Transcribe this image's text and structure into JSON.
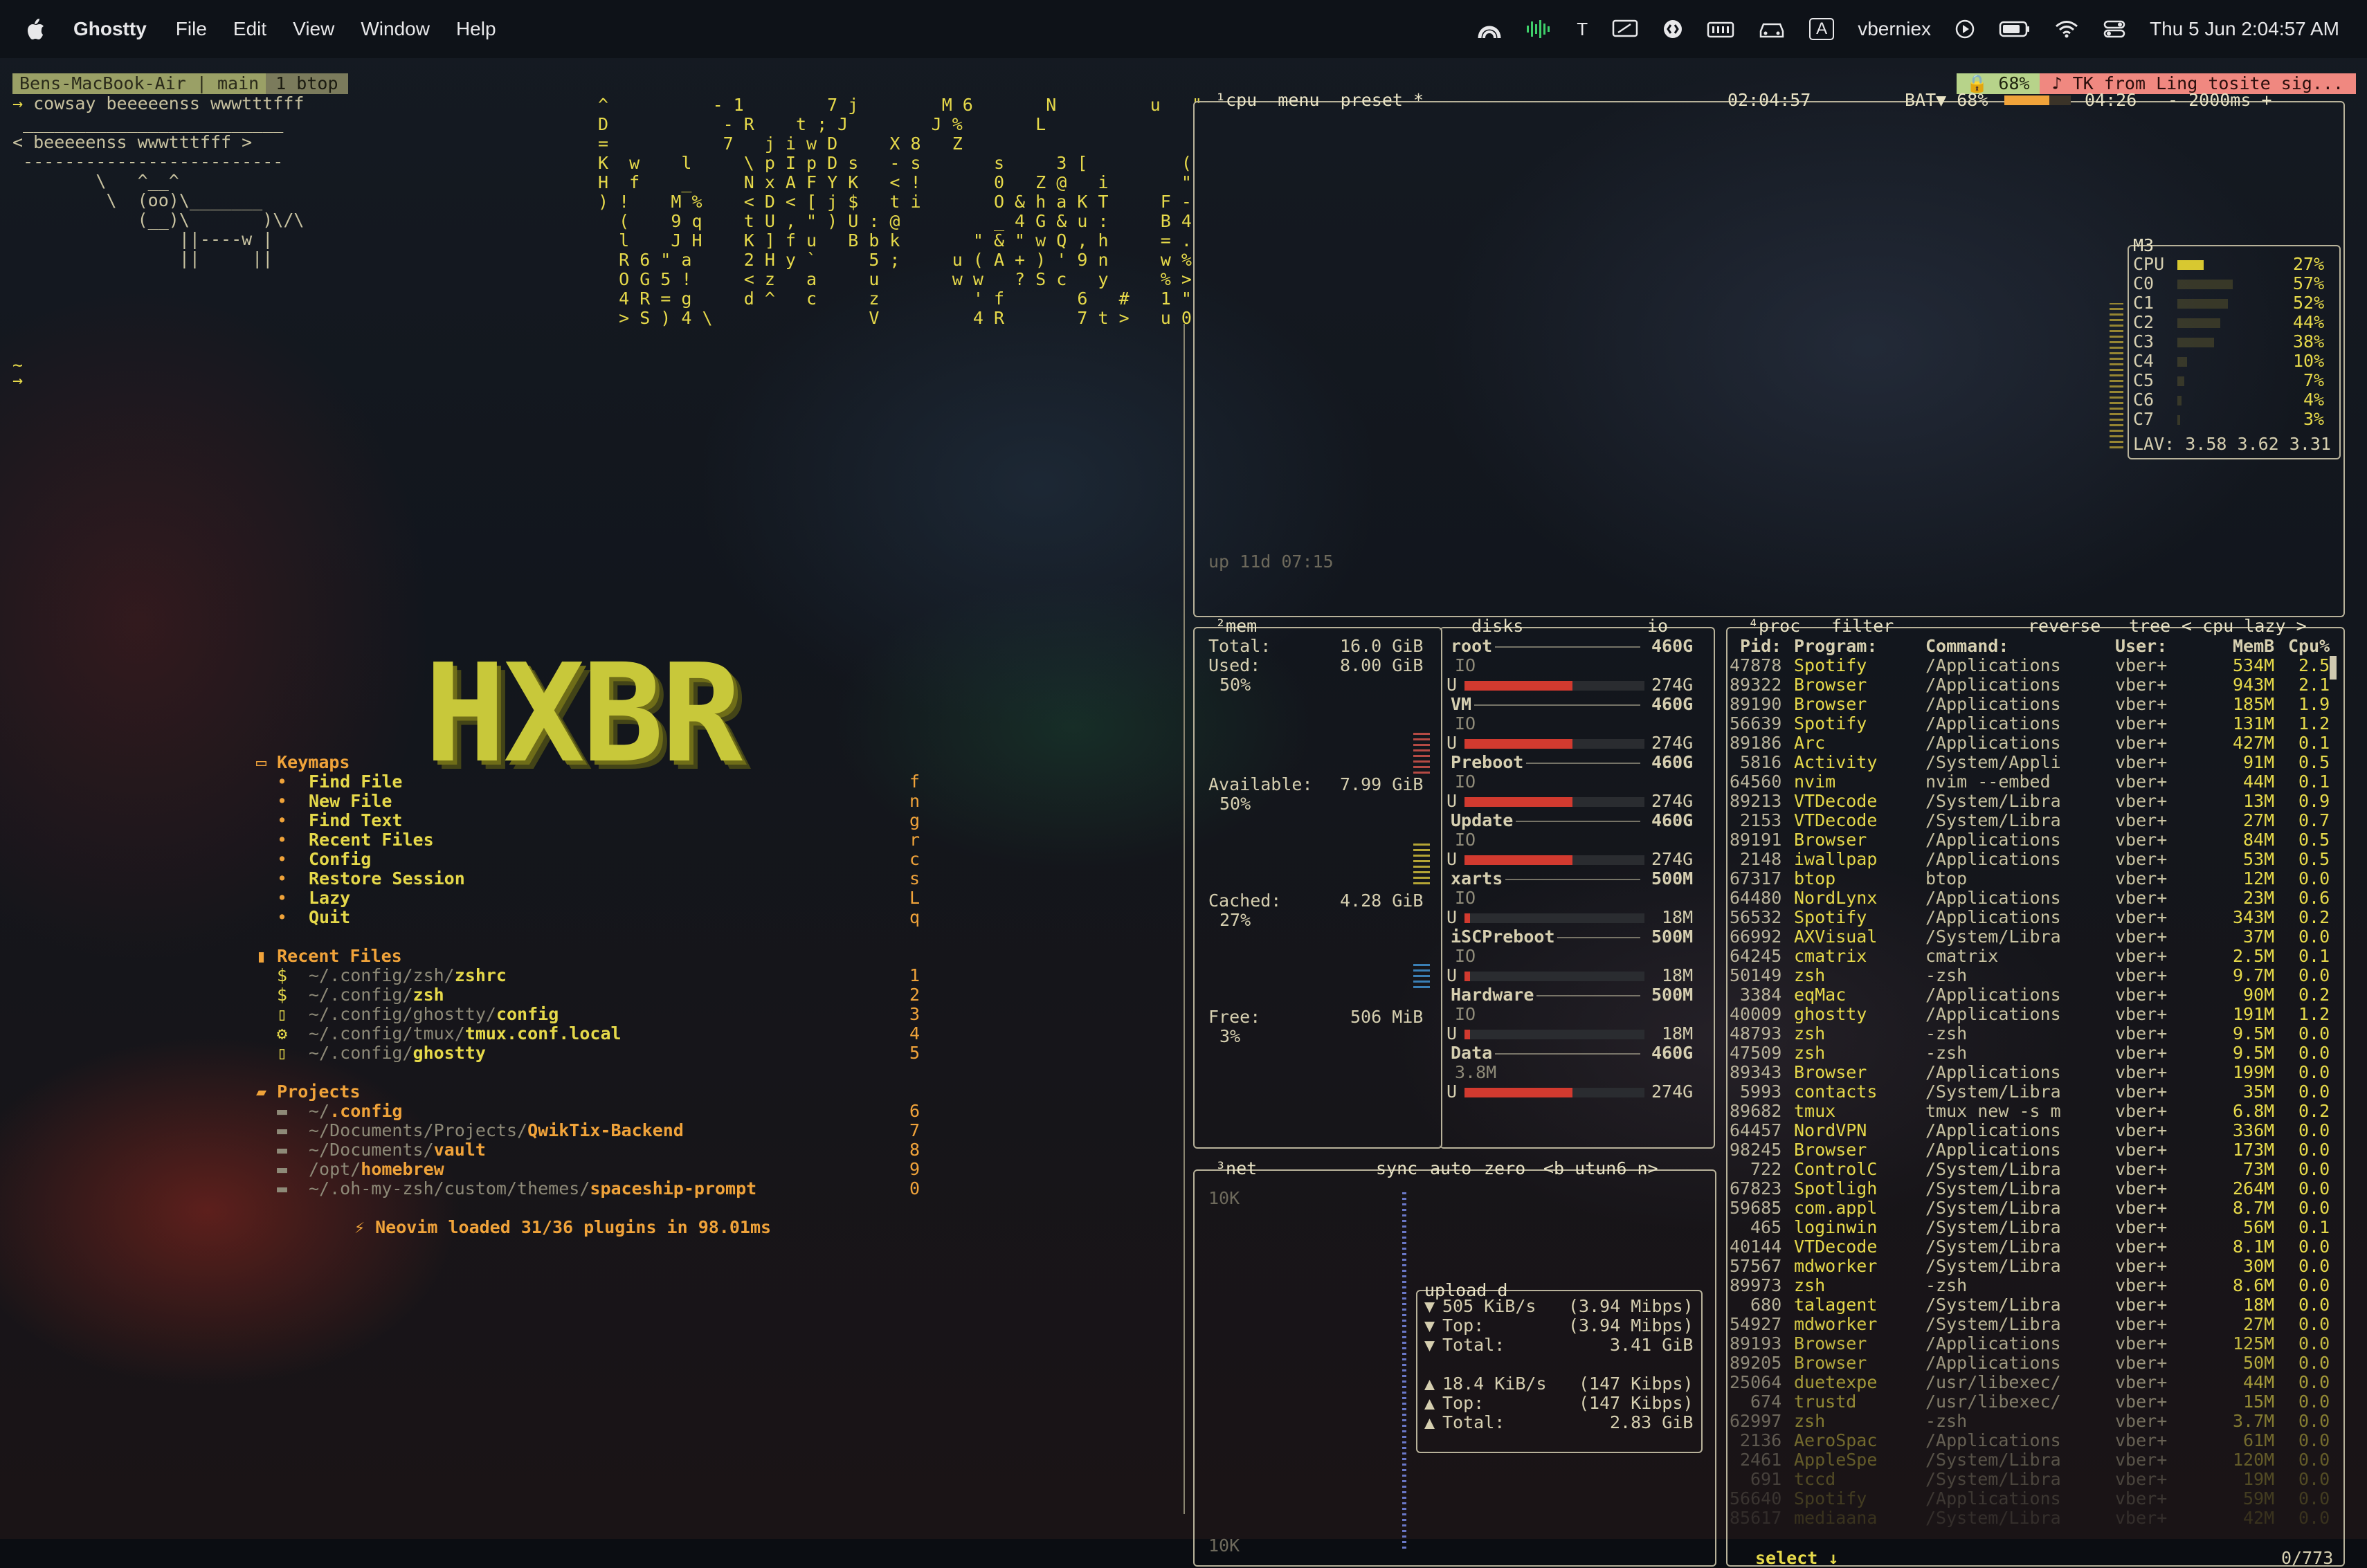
{
  "menubar": {
    "app": "Ghostty",
    "menus": [
      "File",
      "Edit",
      "View",
      "Window",
      "Help"
    ],
    "user": "vberniex",
    "datetime": "Thu 5 Jun  2:04:57 AM",
    "icons": [
      "arc-icon",
      "waveform-icon",
      "t-icon",
      "screen-icon",
      "shazam-icon",
      "keyboard-icon",
      "car-icon",
      "input-source-icon",
      "play-icon",
      "battery-icon",
      "wifi-icon",
      "control-center-icon"
    ],
    "input_source": "A"
  },
  "tmux": {
    "session": "Bens-MacBook-Air | main",
    "window": "1 btop",
    "battery": "68%",
    "battery_icon": "lock-battery-icon",
    "now_playing": "♪ TK from Ling tosite sig..."
  },
  "shell": {
    "prompt": "→",
    "command": "cowsay beeeeenss wwwtttfff",
    "cow": [
      " _________________________",
      "< beeeeenss wwwtttfff >",
      " -------------------------",
      "        \\   ^__^",
      "         \\  (oo)\\_______",
      "            (__)\\       )\\/\\",
      "                ||----w |",
      "                ||     ||"
    ],
    "tilde1": "~",
    "tilde2": "→"
  },
  "matrix_rain": [
    "^          - 1        7 j        M 6       N         u   \"",
    "D           - R    t ; J        J %       L",
    "=           7   j i w D     X 8   Z",
    "K  w    l     \\ p I p D s   - s       s     3 [         (",
    "H  f    _     N x A F Y K   < !       0   Z @   i       \"",
    ") !    M %    < D < [ j $   t i       O & h a K T     F -",
    "  (    9 q    t U , \" ) U : @         _ 4 G & u :     B 4",
    "  l    J H    K ] f u   B b k       \" & \" w Q , h     = .",
    "  R 6 \" a     2 H y `     5 ;     u ( A + ) ' 9 n     w %",
    "  O G 5 !     < z   a     u       w w   ? S c   y     % >",
    "  4 R = g     d ^   c     z         ' f       6   #   1 \"",
    "  > S ) 4 \\               V         4 R       7 t >   u 0"
  ],
  "nvim": {
    "logo": "HXBR",
    "keymaps_title": "Keymaps",
    "keymaps": [
      {
        "icon": "search-icon",
        "label": "Find File",
        "key": "f"
      },
      {
        "icon": "new-file-icon",
        "label": "New File",
        "key": "n"
      },
      {
        "icon": "text-icon",
        "label": "Find Text",
        "key": "g"
      },
      {
        "icon": "recent-icon",
        "label": "Recent Files",
        "key": "r"
      },
      {
        "icon": "gear-icon",
        "label": "Config",
        "key": "c"
      },
      {
        "icon": "restore-icon",
        "label": "Restore Session",
        "key": "s"
      },
      {
        "icon": "sleep-icon",
        "label": "Lazy",
        "key": "L"
      },
      {
        "icon": "quit-icon",
        "label": "Quit",
        "key": "q"
      }
    ],
    "recent_title": "Recent Files",
    "recent": [
      {
        "prefix": "~/.config/zsh/",
        "name": "zshrc",
        "key": "1",
        "icon": "dollar-icon"
      },
      {
        "prefix": "~/.config/",
        "name": "zsh",
        "key": "2",
        "icon": "dollar-icon"
      },
      {
        "prefix": "~/.config/ghostty/",
        "name": "config",
        "key": "3",
        "icon": "file-icon"
      },
      {
        "prefix": "~/.config/tmux/",
        "name": "tmux.conf.local",
        "key": "4",
        "icon": "gear-icon"
      },
      {
        "prefix": "~/.config/",
        "name": "ghostty",
        "key": "5",
        "icon": "file-icon"
      }
    ],
    "projects_title": "Projects",
    "projects": [
      {
        "prefix": "~/",
        "name": ".config",
        "key": "6",
        "icon": "git-folder-icon"
      },
      {
        "prefix": "~/Documents/Projects/",
        "name": "QwikTix-Backend",
        "key": "7",
        "icon": "folder-icon"
      },
      {
        "prefix": "~/Documents/",
        "name": "vault",
        "key": "8",
        "icon": "folder-icon"
      },
      {
        "prefix": "/opt/",
        "name": "homebrew",
        "key": "9",
        "icon": "folder-icon"
      },
      {
        "prefix": "~/.oh-my-zsh/custom/themes/",
        "name": "spaceship-prompt",
        "key": "0",
        "icon": "folder-icon"
      }
    ],
    "footer": "Neovim loaded 31/36 plugins in 98.01ms"
  },
  "btop": {
    "cpu": {
      "header": "¹cpu  menu  preset *",
      "clock": "02:04:57",
      "battery": "BAT▼ 68%",
      "battery_level": 0.68,
      "battery_time": "04:26",
      "interval": "- 2000ms +",
      "uptime": "up 11d 07:15",
      "chip": "M3",
      "cores": [
        {
          "name": "CPU",
          "pct": "27%",
          "level": 0.27
        },
        {
          "name": "C0",
          "pct": "57%",
          "level": 0.57
        },
        {
          "name": "C1",
          "pct": "52%",
          "level": 0.52
        },
        {
          "name": "C2",
          "pct": "44%",
          "level": 0.44
        },
        {
          "name": "C3",
          "pct": "38%",
          "level": 0.38
        },
        {
          "name": "C4",
          "pct": "10%",
          "level": 0.1
        },
        {
          "name": "C5",
          "pct": "7%",
          "level": 0.07
        },
        {
          "name": "C6",
          "pct": "4%",
          "level": 0.04
        },
        {
          "name": "C7",
          "pct": "3%",
          "level": 0.03
        }
      ],
      "load": "LAV: 3.58 3.62 3.31"
    },
    "mem": {
      "title": "²mem",
      "rows": [
        {
          "label": "Total:",
          "value": "16.0 GiB"
        },
        {
          "label": "Used:",
          "value": "8.00 GiB",
          "pct": "50%"
        },
        {
          "label": "Available:",
          "value": "7.99 GiB",
          "pct": "50%"
        },
        {
          "label": "Cached:",
          "value": "4.28 GiB",
          "pct": "27%"
        },
        {
          "label": "Free:",
          "value": "506 MiB",
          "pct": "3%"
        }
      ]
    },
    "disks": {
      "title": "disks",
      "io": "io",
      "list": [
        {
          "name": "root",
          "size": "460G",
          "io": "IO",
          "used": "274G",
          "level": 0.6
        },
        {
          "name": "VM",
          "size": "460G",
          "io": "IO",
          "used": "274G",
          "level": 0.6
        },
        {
          "name": "Preboot",
          "size": "460G",
          "io": "IO",
          "used": "274G",
          "level": 0.6
        },
        {
          "name": "Update",
          "size": "460G",
          "io": "IO",
          "used": "274G",
          "level": 0.6
        },
        {
          "name": "xarts",
          "size": "500M",
          "io": "IO",
          "used": "18M",
          "level": 0.03
        },
        {
          "name": "iSCPreboot",
          "size": "500M",
          "io": "IO",
          "used": "18M",
          "level": 0.03
        },
        {
          "name": "Hardware",
          "size": "500M",
          "io": "IO",
          "used": "18M",
          "level": 0.03
        },
        {
          "name": "Data",
          "size": "460G",
          "io": "3.8M",
          "used": "274G",
          "level": 0.6
        }
      ]
    },
    "net": {
      "title": "³net",
      "options": [
        "sync",
        "auto",
        "zero",
        "<b utun6 n>"
      ],
      "scale_top": "10K",
      "scale_bottom": "10K",
      "box_title": "upload",
      "box_title2": "d",
      "upload": [
        {
          "arrow": "▼",
          "label": "505 KiB/s",
          "value": "(3.94 Mibps)"
        },
        {
          "arrow": "▼",
          "label": "Top:",
          "value": "(3.94 Mibps)"
        },
        {
          "arrow": "▼",
          "label": "Total:",
          "value": "3.41 GiB"
        }
      ],
      "download": [
        {
          "arrow": "▲",
          "label": "18.4 KiB/s",
          "value": "(147 Kibps)"
        },
        {
          "arrow": "▲",
          "label": "Top:",
          "value": "(147 Kibps)"
        },
        {
          "arrow": "▲",
          "label": "Total:",
          "value": "2.83 GiB"
        }
      ]
    },
    "proc": {
      "title": "⁴proc",
      "filter": "filter",
      "options": [
        "reverse",
        "tree",
        "< cpu lazy >"
      ],
      "columns": [
        "Pid:",
        "Program:",
        "Command:",
        "User:",
        "MemB",
        "Cpu%"
      ],
      "rows": [
        [
          "47878",
          "Spotify",
          "/Applications",
          "vber+",
          "534M",
          "2.5"
        ],
        [
          "89322",
          "Browser",
          "/Applications",
          "vber+",
          "943M",
          "2.1"
        ],
        [
          "89190",
          "Browser",
          "/Applications",
          "vber+",
          "185M",
          "1.9"
        ],
        [
          "56639",
          "Spotify",
          "/Applications",
          "vber+",
          "131M",
          "1.2"
        ],
        [
          "89186",
          "Arc",
          "/Applications",
          "vber+",
          "427M",
          "0.1"
        ],
        [
          "5816",
          "Activity",
          "/System/Appli",
          "vber+",
          "91M",
          "0.5"
        ],
        [
          "64560",
          "nvim",
          "nvim --embed",
          "vber+",
          "44M",
          "0.1"
        ],
        [
          "89213",
          "VTDecode",
          "/System/Libra",
          "vber+",
          "13M",
          "0.9"
        ],
        [
          "2153",
          "VTDecode",
          "/System/Libra",
          "vber+",
          "27M",
          "0.7"
        ],
        [
          "89191",
          "Browser",
          "/Applications",
          "vber+",
          "84M",
          "0.5"
        ],
        [
          "2148",
          "iwallpap",
          "/Applications",
          "vber+",
          "53M",
          "0.5"
        ],
        [
          "67317",
          "btop",
          "btop",
          "vber+",
          "12M",
          "0.0"
        ],
        [
          "64480",
          "NordLynx",
          "/Applications",
          "vber+",
          "23M",
          "0.6"
        ],
        [
          "56532",
          "Spotify",
          "/Applications",
          "vber+",
          "343M",
          "0.2"
        ],
        [
          "66992",
          "AXVisual",
          "/System/Libra",
          "vber+",
          "37M",
          "0.0"
        ],
        [
          "64245",
          "cmatrix",
          "cmatrix",
          "vber+",
          "2.5M",
          "0.1"
        ],
        [
          "50149",
          "zsh",
          "-zsh",
          "vber+",
          "9.7M",
          "0.0"
        ],
        [
          "3384",
          "eqMac",
          "/Applications",
          "vber+",
          "90M",
          "0.2"
        ],
        [
          "40009",
          "ghostty",
          "/Applications",
          "vber+",
          "191M",
          "1.2"
        ],
        [
          "48793",
          "zsh",
          "-zsh",
          "vber+",
          "9.5M",
          "0.0"
        ],
        [
          "47509",
          "zsh",
          "-zsh",
          "vber+",
          "9.5M",
          "0.0"
        ],
        [
          "89343",
          "Browser",
          "/Applications",
          "vber+",
          "199M",
          "0.0"
        ],
        [
          "5993",
          "contacts",
          "/System/Libra",
          "vber+",
          "35M",
          "0.0"
        ],
        [
          "89682",
          "tmux",
          "tmux new -s m",
          "vber+",
          "6.8M",
          "0.2"
        ],
        [
          "64457",
          "NordVPN",
          "/Applications",
          "vber+",
          "336M",
          "0.0"
        ],
        [
          "98245",
          "Browser",
          "/Applications",
          "vber+",
          "173M",
          "0.0"
        ],
        [
          "722",
          "ControlC",
          "/System/Libra",
          "vber+",
          "73M",
          "0.0"
        ],
        [
          "67823",
          "Spotligh",
          "/System/Libra",
          "vber+",
          "264M",
          "0.0"
        ],
        [
          "59685",
          "com.appl",
          "/System/Libra",
          "vber+",
          "8.7M",
          "0.0"
        ],
        [
          "465",
          "loginwin",
          "/System/Libra",
          "vber+",
          "56M",
          "0.1"
        ],
        [
          "40144",
          "VTDecode",
          "/System/Libra",
          "vber+",
          "8.1M",
          "0.0"
        ],
        [
          "57567",
          "mdworker",
          "/System/Libra",
          "vber+",
          "30M",
          "0.0"
        ],
        [
          "89973",
          "zsh",
          "-zsh",
          "vber+",
          "8.6M",
          "0.0"
        ],
        [
          "680",
          "talagent",
          "/System/Libra",
          "vber+",
          "18M",
          "0.0"
        ],
        [
          "54927",
          "mdworker",
          "/System/Libra",
          "vber+",
          "27M",
          "0.0"
        ],
        [
          "89193",
          "Browser",
          "/Applications",
          "vber+",
          "125M",
          "0.0"
        ],
        [
          "89205",
          "Browser",
          "/Applications",
          "vber+",
          "50M",
          "0.0"
        ],
        [
          "25064",
          "duetexpe",
          "/usr/libexec/",
          "vber+",
          "44M",
          "0.0"
        ],
        [
          "674",
          "trustd",
          "/usr/libexec/",
          "vber+",
          "15M",
          "0.0"
        ],
        [
          "62997",
          "zsh",
          "-zsh",
          "vber+",
          "3.7M",
          "0.0"
        ],
        [
          "2136",
          "AeroSpac",
          "/Applications",
          "vber+",
          "61M",
          "0.0"
        ],
        [
          "2461",
          "AppleSpe",
          "/System/Libra",
          "vber+",
          "120M",
          "0.0"
        ],
        [
          "691",
          "tccd",
          "/System/Libra",
          "vber+",
          "19M",
          "0.0"
        ],
        [
          "56640",
          "Spotify",
          "/Applications",
          "vber+",
          "59M",
          "0.0"
        ],
        [
          "85617",
          "mediaana",
          "/System/Libra",
          "vber+",
          "42M",
          "0.0"
        ]
      ],
      "footer_select": "select ↓",
      "footer_count": "0/773"
    }
  }
}
